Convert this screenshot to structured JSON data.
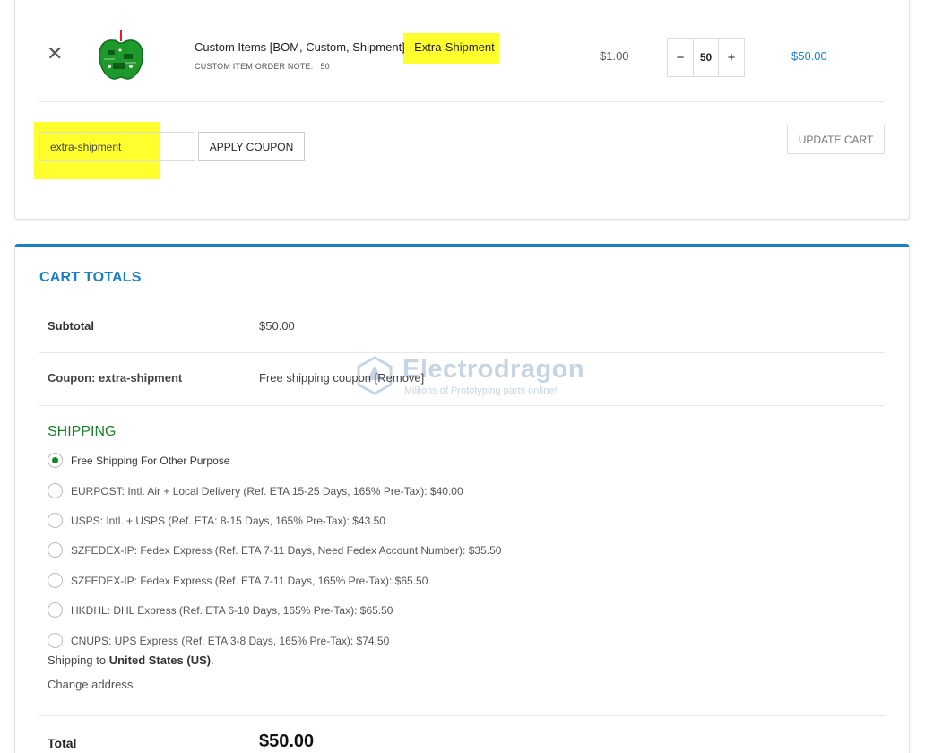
{
  "cart": {
    "item": {
      "remove_symbol": "✕",
      "name_part1": "Custom Items [BOM, Custom, Shipment]",
      "name_sep": "-",
      "name_part2": "Extra-Shipment",
      "note_label": "CUSTOM ITEM ORDER NOTE:",
      "note_value": "50",
      "price": "$1.00",
      "quantity": "50",
      "qty_minus": "−",
      "qty_plus": "+",
      "line_total": "$50.00"
    },
    "coupon_value": "extra-shipment",
    "apply_coupon_label": "APPLY COUPON",
    "update_cart_label": "UPDATE CART"
  },
  "totals": {
    "title": "CART TOTALS",
    "subtotal_label": "Subtotal",
    "subtotal_value": "$50.00",
    "coupon_label": "Coupon: extra-shipment",
    "coupon_value": "Free shipping coupon [Remove]",
    "shipping_label": "SHIPPING",
    "shipping_options": [
      {
        "label": "Free Shipping For Other Purpose",
        "checked": true
      },
      {
        "label": "EURPOST: Intl. Air + Local Delivery (Ref. ETA 15-25 Days, 165% Pre-Tax): $40.00",
        "checked": false
      },
      {
        "label": "USPS: Intl. + USPS (Ref. ETA: 8-15 Days, 165% Pre-Tax): $43.50",
        "checked": false
      },
      {
        "label": "SZFEDEX-IP: Fedex Express (Ref. ETA 7-11 Days, Need Fedex Account Number): $35.50",
        "checked": false
      },
      {
        "label": "SZFEDEX-IP: Fedex Express (Ref. ETA 7-11 Days, 165% Pre-Tax): $65.50",
        "checked": false
      },
      {
        "label": "HKDHL: DHL Express (Ref. ETA 6-10 Days, 165% Pre-Tax): $65.50",
        "checked": false
      },
      {
        "label": "CNUPS: UPS Express (Ref. ETA 3-8 Days, 165% Pre-Tax): $74.50",
        "checked": false
      }
    ],
    "ship_to_prefix": "Shipping to",
    "ship_to_country": "United States (US)",
    "ship_to_suffix": ".",
    "change_address_label": "Change address",
    "total_label": "Total",
    "total_value": "$50.00"
  },
  "watermark": {
    "name": "Electrodragon",
    "tagline": "Millions of Prototyping parts online!"
  },
  "colors": {
    "accent": "#1a7fc4",
    "highlight": "#ffff2e",
    "shipping_green": "#1a7f2a",
    "radio_checked": "#0b8a1f"
  }
}
